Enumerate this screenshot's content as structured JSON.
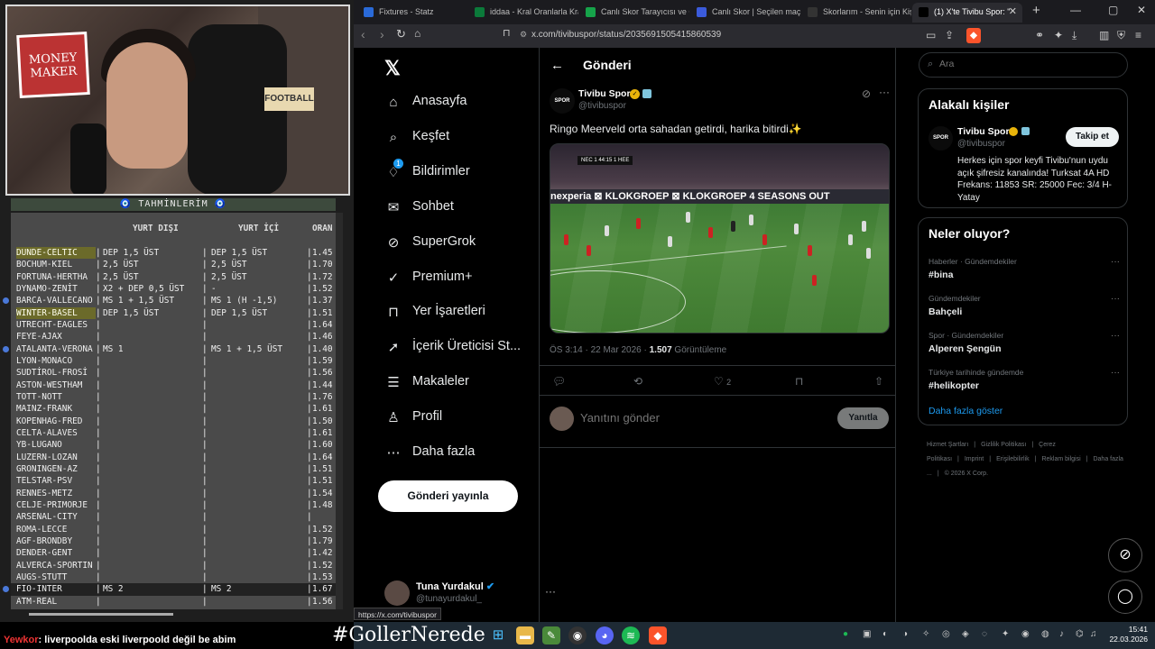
{
  "stream": {
    "tahminler_title": "TAHMİNLERİM",
    "cols": {
      "yurt_disi": "YURT DIŞI",
      "yurt_ici": "YURT İÇİ",
      "oran": "ORAN"
    },
    "rows": [
      {
        "match": "DUNDE-CELTIC",
        "d": "DEP 1,5 ÜST",
        "i": "DEP 1,5 ÜST",
        "o": "1.45",
        "hl": true
      },
      {
        "match": "BOCHUM-KIEL",
        "d": "2,5 ÜST",
        "i": "2,5 ÜST",
        "o": "1.70"
      },
      {
        "match": "FORTUNA-HERTHA",
        "d": "2,5 ÜST",
        "i": "2,5 ÜST",
        "o": "1.72"
      },
      {
        "match": "DYNAMO-ZENİT",
        "d": "X2 + DEP 0,5 ÜST",
        "i": "-",
        "o": "1.52"
      },
      {
        "match": "BARCA-VALLECANO",
        "d": "MS 1 + 1,5 ÜST",
        "i": "MS 1 (H -1,5)",
        "o": "1.37",
        "dot": true
      },
      {
        "match": "WINTER-BASEL",
        "d": "DEP 1,5 ÜST",
        "i": "DEP 1,5 ÜST",
        "o": "1.51",
        "hl": true
      },
      {
        "match": "UTRECHT-EAGLES",
        "d": "",
        "i": "",
        "o": "1.64"
      },
      {
        "match": "FEYE-AJAX",
        "d": "",
        "i": "",
        "o": "1.46"
      },
      {
        "match": "ATALANTA-VERONA",
        "d": "MS 1",
        "i": "MS 1 + 1,5 ÜST",
        "o": "1.40",
        "dot": true
      },
      {
        "match": "LYON-MONACO",
        "d": "",
        "i": "",
        "o": "1.59"
      },
      {
        "match": "SUDTİROL-FROSİ",
        "d": "",
        "i": "",
        "o": "1.56"
      },
      {
        "match": "ASTON-WESTHAM",
        "d": "",
        "i": "",
        "o": "1.44"
      },
      {
        "match": "TOTT-NOTT",
        "d": "",
        "i": "",
        "o": "1.76"
      },
      {
        "match": "MAINZ-FRANK",
        "d": "",
        "i": "",
        "o": "1.61"
      },
      {
        "match": "KOPENHAG-FRED",
        "d": "",
        "i": "",
        "o": "1.50"
      },
      {
        "match": "CELTA-ALAVES",
        "d": "",
        "i": "",
        "o": "1.61"
      },
      {
        "match": "YB-LUGANO",
        "d": "",
        "i": "",
        "o": "1.60"
      },
      {
        "match": "LUZERN-LOZAN",
        "d": "",
        "i": "",
        "o": "1.64"
      },
      {
        "match": "GRONINGEN-AZ",
        "d": "",
        "i": "",
        "o": "1.51"
      },
      {
        "match": "TELSTAR-PSV",
        "d": "",
        "i": "",
        "o": "1.51"
      },
      {
        "match": "RENNES-METZ",
        "d": "",
        "i": "",
        "o": "1.54"
      },
      {
        "match": "CELJE-PRIMORJE",
        "d": "",
        "i": "",
        "o": "1.48"
      },
      {
        "match": "ARSENAL-CITY",
        "d": "",
        "i": "",
        "o": ""
      },
      {
        "match": "ROMA-LECCE",
        "d": "",
        "i": "",
        "o": "1.52"
      },
      {
        "match": "AGF-BRONDBY",
        "d": "",
        "i": "",
        "o": "1.79"
      },
      {
        "match": "DENDER-GENT",
        "d": "",
        "i": "",
        "o": "1.42"
      },
      {
        "match": "ALVERCA-SPORTIN",
        "d": "",
        "i": "",
        "o": "1.52"
      },
      {
        "match": "AUGS-STUTT",
        "d": "",
        "i": "",
        "o": "1.53"
      },
      {
        "match": "FIO-INTER",
        "d": "MS 2",
        "i": "MS 2",
        "o": "1.67",
        "dot": true,
        "sel": true
      },
      {
        "match": "ATM-REAL",
        "d": "",
        "i": "",
        "o": "1.56"
      }
    ],
    "webcam": {
      "poster_text": "MONEY MAKER",
      "sign_text": "FOOTBALL"
    },
    "chat": {
      "user": "Yewkor",
      "message": ": liverpoolda eski liverpoold değil be abim"
    },
    "hashtag": "#GollerNerede"
  },
  "browser": {
    "tabs": [
      {
        "title": "Fixtures - Statz",
        "icon_color": "#2a6ad8",
        "icon": "github-icon"
      },
      {
        "title": "iddaa - Kral Oranlarla Kral",
        "icon_color": "#0b7a3a",
        "icon": "iddaa-icon"
      },
      {
        "title": "Canlı Skor Tarayıcısı ve Ca",
        "icon_color": "#16a34a",
        "icon": "livescore-icon"
      },
      {
        "title": "Canlı Skor | Seçilen maçla",
        "icon_color": "#3b5bdb",
        "icon": "livescore-icon"
      },
      {
        "title": "Skorlarım - Senin için Kişi",
        "icon_color": "#333333",
        "icon": "score-icon"
      },
      {
        "title": "(1) X'te Tivibu Spor: \"",
        "icon_color": "#000000",
        "icon": "x-icon",
        "active": true
      }
    ],
    "url": "x.com/tivibuspor/status/2035691505415860539",
    "status_url": "https://x.com/tivibuspor"
  },
  "x": {
    "nav": [
      {
        "label": "Anasayfa",
        "icon": "home-icon",
        "glyph": "⌂"
      },
      {
        "label": "Keşfet",
        "icon": "search-icon",
        "glyph": "⌕"
      },
      {
        "label": "Bildirimler",
        "icon": "bell-icon",
        "glyph": "♢",
        "badge": "1"
      },
      {
        "label": "Sohbet",
        "icon": "mail-icon",
        "glyph": "✉"
      },
      {
        "label": "SuperGrok",
        "icon": "grok-icon",
        "glyph": "⊘"
      },
      {
        "label": "Premium+",
        "icon": "premium-icon",
        "glyph": "✓"
      },
      {
        "label": "Yer İşaretleri",
        "icon": "bookmark-icon",
        "glyph": "⊓"
      },
      {
        "label": "İçerik Üreticisi St...",
        "icon": "rocket-icon",
        "glyph": "➚"
      },
      {
        "label": "Makaleler",
        "icon": "article-icon",
        "glyph": "☰"
      },
      {
        "label": "Profil",
        "icon": "person-icon",
        "glyph": "♙"
      },
      {
        "label": "Daha fazla",
        "icon": "more-icon",
        "glyph": "⋯"
      }
    ],
    "post_button": "Gönderi yayınla",
    "account": {
      "name": "Tuna Yurdakul",
      "handle": "@tunayurdakul_"
    },
    "page_title": "Gönderi",
    "tweet": {
      "name": "Tivibu Spor",
      "handle": "@tivibuspor",
      "avatar_text": "SPOR",
      "text": "Ringo Meerveld orta sahadan getirdi, harika bitirdi✨",
      "time": "ÖS 3:14 · 22 Mar 2026 · ",
      "views": "1.507",
      "views_label": " Görüntüleme",
      "likes": "2",
      "media": {
        "adboard": "nexperia  ⊠ KLOKGROEP ⊠ KLOKGROEP    4 SEASONS OUT",
        "score": "NEC 1 44:15 1 HEE"
      }
    },
    "reply": {
      "placeholder": "Yanıtını gönder",
      "button": "Yanıtla"
    },
    "search_placeholder": "Ara",
    "related": {
      "title": "Alakalı kişiler",
      "name": "Tivibu Spor",
      "handle": "@tivibuspor",
      "follow": "Takip et",
      "bio": "Herkes için spor keyfi Tivibu'nun uydu açık şifresiz kanalında! Turksat 4A HD Frekans: 11853 SR: 25000 Fec: 3/4 H-Yatay"
    },
    "trends": {
      "title": "Neler oluyor?",
      "items": [
        {
          "cat": "Haberler · Gündemdekiler",
          "name": "#bina"
        },
        {
          "cat": "Gündemdekiler",
          "name": "Bahçeli"
        },
        {
          "cat": "Spor · Gündemdekiler",
          "name": "Alperen Şengün"
        },
        {
          "cat": "Türkiye tarihinde gündemde",
          "name": "#helikopter"
        }
      ],
      "show_more": "Daha fazla göster"
    },
    "footer": [
      "Hizmet Şartları",
      "Gizlilik Politikası",
      "Çerez Politikası",
      "Imprint",
      "Erişilebilirlik",
      "Reklam bilgisi",
      "Daha fazla ...",
      "© 2026 X Corp."
    ]
  },
  "taskbar": {
    "time": "15:41",
    "date": "22.03.2026"
  },
  "colors": {
    "accent": "#1d9bf0",
    "brave": "#fb542b",
    "highlight": "#6b6a2a"
  }
}
